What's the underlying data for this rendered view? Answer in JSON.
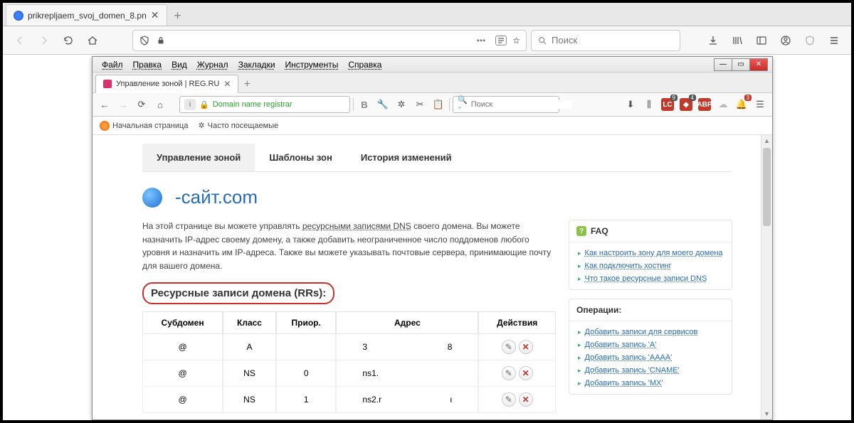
{
  "outer": {
    "tab_title": "prikrepljaem_svoj_domen_8.pn",
    "search_placeholder": "Поиск"
  },
  "inner": {
    "menubar": {
      "file": "Файл",
      "edit": "Правка",
      "view": "Вид",
      "history": "Журнал",
      "bookmarks": "Закладки",
      "tools": "Инструменты",
      "help": "Справка"
    },
    "tab_title": "Управление зоной | REG.RU",
    "addr_label": "Domain name registrar",
    "search_placeholder": "Поиск",
    "bookmark1": "Начальная страница",
    "bookmark2": "Часто посещаемые",
    "ext_badges": {
      "lc": "9",
      "ab": "4",
      "abp": "",
      "bell": "3"
    }
  },
  "page": {
    "tabs": {
      "zone": "Управление зоной",
      "templates": "Шаблоны зон",
      "history": "История изменений"
    },
    "domain": "-сайт.com",
    "desc_p1a": "На этой странице вы можете управлять ",
    "desc_p1_link": "ресурсными записями DNS",
    "desc_p1b": " своего домена. Вы можете назначить IP-адрес своему домену, а также добавить неограниченное число поддоменов любого уровня и назначить им IP-адреса. Также вы можете указывать почтовые сервера, принимающие почту для вашего домена.",
    "rrs_heading": "Ресурсные записи домена (RRs):",
    "table_headers": {
      "sub": "Субдомен",
      "class": "Класс",
      "prio": "Приор.",
      "addr": "Адрес",
      "actions": "Действия"
    },
    "rows": [
      {
        "sub": "@",
        "class": "A",
        "prio": "",
        "addr_a": "3",
        "addr_b": "8"
      },
      {
        "sub": "@",
        "class": "NS",
        "prio": "0",
        "addr_a": "ns1.",
        "addr_b": ""
      },
      {
        "sub": "@",
        "class": "NS",
        "prio": "1",
        "addr_a": "ns2.r",
        "addr_b": "ı"
      }
    ],
    "faq_title": "FAQ",
    "faq_links": [
      "Как настроить зону для моего домена",
      "Как подключить хостинг",
      "Что такое ресурсные записи DNS"
    ],
    "ops_title": "Операции:",
    "ops_links": [
      "Добавить записи для сервисов",
      "Добавить запись 'A'",
      "Добавить запись 'AAAA'",
      "Добавить запись 'CNAME'",
      "Добавить запись 'MX'"
    ]
  }
}
